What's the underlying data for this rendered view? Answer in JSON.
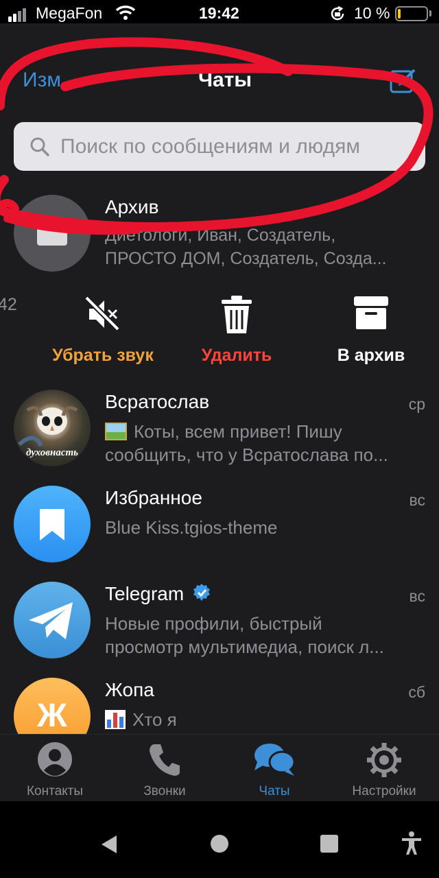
{
  "status_bar": {
    "carrier": "MegaFon",
    "time": "19:42",
    "battery_percent": "10 %",
    "battery_level": 0.1
  },
  "nav": {
    "edit_label": "Изм",
    "title": "Чаты"
  },
  "search": {
    "placeholder": "Поиск по сообщениям и людям"
  },
  "archive": {
    "name": "Архив",
    "preview_line1": "Диетологи, Иван, Создатель,",
    "preview_line2": "ПРОСТО ДОМ, Создатель, Созда..."
  },
  "swipe": {
    "time_fragment": ":42",
    "mute_label": "Убрать звук",
    "delete_label": "Удалить",
    "archive_label": "В архив",
    "mute_color": "#f2a23c",
    "delete_color": "#ff453a"
  },
  "chats": [
    {
      "name": "Всратослав",
      "date": "ср",
      "preview_line1": "Коты, всем привет!  Пишу",
      "preview_line2": "сообщить, что у Всратослава по...",
      "avatar_caption": "духовнасть"
    },
    {
      "name": "Избранное",
      "date": "вс",
      "preview_line1": "Blue Kiss.tgios-theme",
      "preview_line2": ""
    },
    {
      "name": "Telegram",
      "date": "вс",
      "preview_line1": "Новые профили, быстрый",
      "preview_line2": "просмотр мультимедиа, поиск л...",
      "verified": true
    },
    {
      "name": "Жопа",
      "date": "сб",
      "preview_line1": "Хто я",
      "preview_line2": "",
      "avatar_letter": "Ж"
    }
  ],
  "tabs": [
    {
      "label": "Контакты",
      "icon": "person-circle-icon"
    },
    {
      "label": "Звонки",
      "icon": "phone-icon"
    },
    {
      "label": "Чаты",
      "icon": "chat-bubbles-icon",
      "active": true
    },
    {
      "label": "Настройки",
      "icon": "gear-icon"
    }
  ],
  "colors": {
    "accent": "#3d8fd8",
    "background": "#1c1c1e",
    "secondary_text": "#8e8e93",
    "scribble": "#e8132c"
  }
}
